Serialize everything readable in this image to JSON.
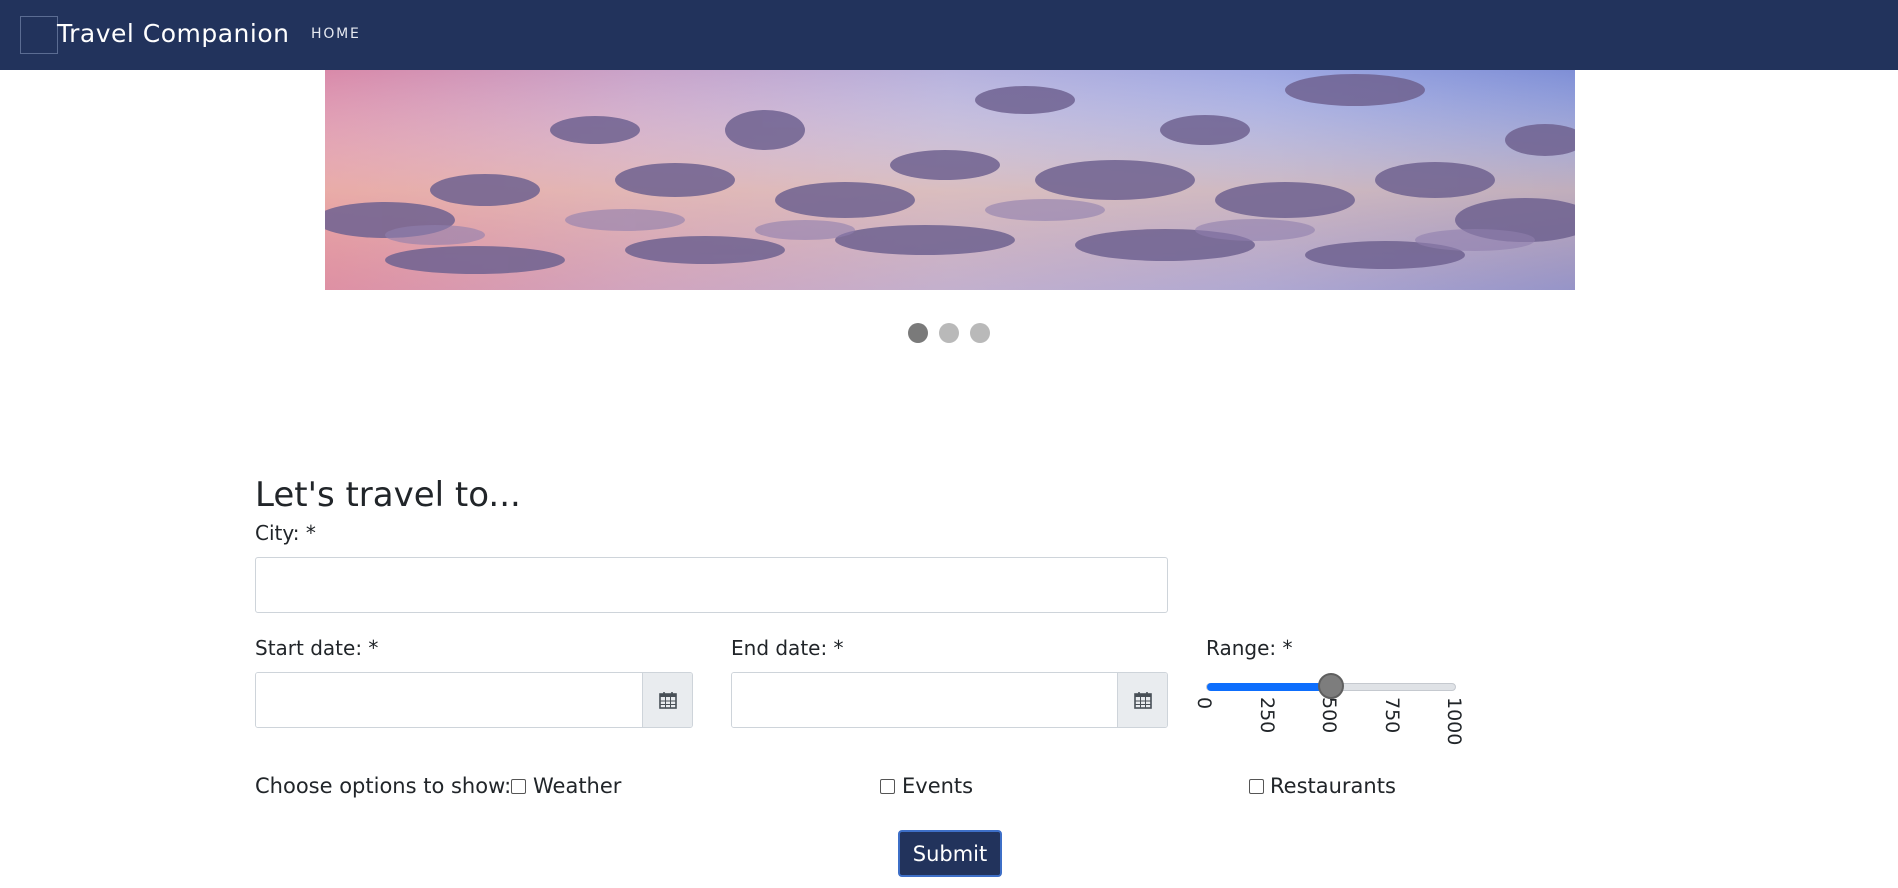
{
  "navbar": {
    "brand": "Travel Companion",
    "links": [
      "HOME"
    ],
    "background": "#22335c"
  },
  "carousel": {
    "slide_count": 3,
    "active_index": 0
  },
  "form": {
    "title": "Let's travel to...",
    "city": {
      "label": "City: *",
      "value": ""
    },
    "start_date": {
      "label": "Start date: *",
      "value": "",
      "icon": "calendar-icon"
    },
    "end_date": {
      "label": "End date: *",
      "value": "",
      "icon": "calendar-icon"
    },
    "range": {
      "label": "Range: *",
      "min": 0,
      "max": 1000,
      "value": 500,
      "ticks": [
        "0",
        "250",
        "500",
        "750",
        "1000"
      ],
      "fill_color": "#0d6efd"
    },
    "options": {
      "label": "Choose options to show:",
      "items": [
        {
          "label": "Weather",
          "checked": false
        },
        {
          "label": "Events",
          "checked": false
        },
        {
          "label": "Restaurants",
          "checked": false
        }
      ]
    },
    "submit_label": "Submit"
  }
}
